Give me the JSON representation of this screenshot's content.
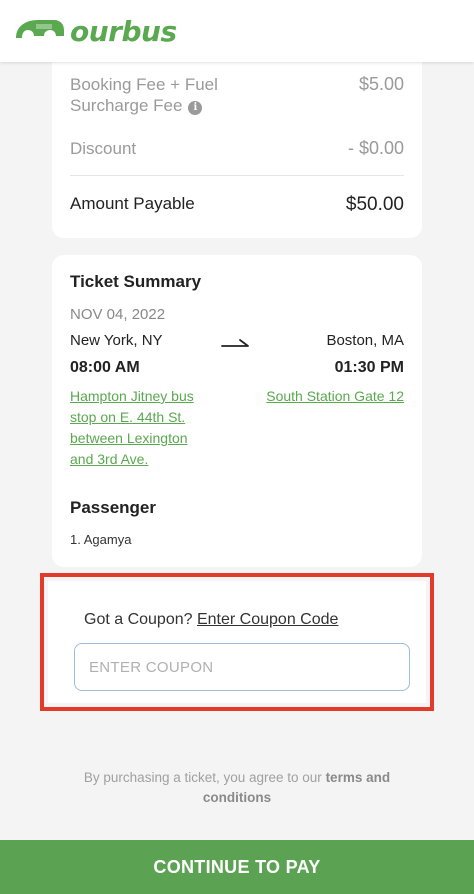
{
  "brand": {
    "name": "ourbus",
    "color": "#5aa84f"
  },
  "fees": {
    "booking_label_line1": "Booking Fee + Fuel",
    "booking_label_line2": "Surcharge Fee",
    "booking_value": "$5.00",
    "discount_label": "Discount",
    "discount_value": "- $0.00",
    "payable_label": "Amount Payable",
    "payable_value": "$50.00"
  },
  "ticket_summary": {
    "title": "Ticket Summary",
    "date": "NOV 04, 2022",
    "from_city": "New York, NY",
    "to_city": "Boston, MA",
    "departure_time": "08:00 AM",
    "arrival_time": "01:30 PM",
    "from_stop": "Hampton Jitney bus stop on E. 44th St. between Lexington and 3rd Ave.",
    "to_stop": "South Station Gate 12"
  },
  "passenger": {
    "title": "Passenger",
    "items": [
      "1. Agamya"
    ]
  },
  "coupon": {
    "prompt": "Got a Coupon?",
    "link_label": "Enter Coupon Code",
    "placeholder": "ENTER COUPON",
    "value": "",
    "highlight_color": "#e23b29"
  },
  "terms": {
    "text": "By purchasing a ticket, you agree to our",
    "link_label": "terms and conditions"
  },
  "cta": {
    "label": "CONTINUE TO PAY",
    "color": "#5ba352"
  }
}
